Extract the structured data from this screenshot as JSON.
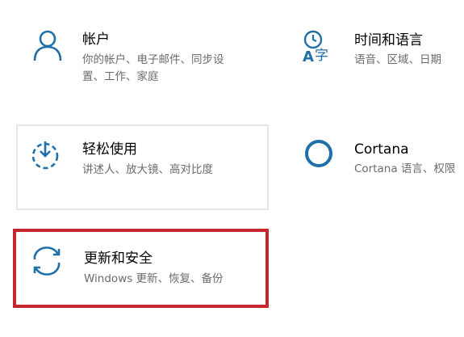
{
  "colors": {
    "icon_blue": "#1f6fa8",
    "highlight_red": "#c4262e",
    "title_text": "#000000",
    "desc_text": "#6b6b6b",
    "tile_border": "#e6e6e6"
  },
  "tiles": [
    {
      "id": "accounts",
      "icon": "person-icon",
      "title": "帐户",
      "desc_lines": [
        "你的帐户、电子邮件、同步设",
        "置、工作、家庭"
      ]
    },
    {
      "id": "time-language",
      "icon": "time-language-icon",
      "title": "时间和语言",
      "desc_lines": [
        "语音、区域、日期"
      ]
    },
    {
      "id": "ease-of-access",
      "icon": "ease-of-access-icon",
      "title": "轻松使用",
      "desc_lines": [
        "讲述人、放大镜、高对比度"
      ]
    },
    {
      "id": "cortana",
      "icon": "cortana-ring-icon",
      "title": "Cortana",
      "desc_lines": [
        "Cortana 语言、权限"
      ]
    },
    {
      "id": "update-security",
      "icon": "sync-icon",
      "title": "更新和安全",
      "desc_lines": [
        "Windows 更新、恢复、备份"
      ]
    }
  ]
}
